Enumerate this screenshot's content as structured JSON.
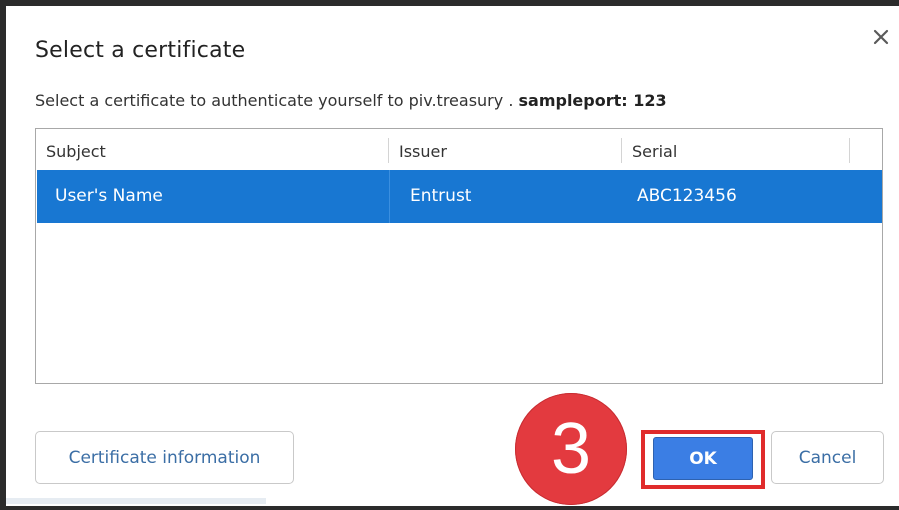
{
  "dialog": {
    "title": "Select a certificate",
    "description_prefix": "Select a certificate to authenticate yourself to piv.treasury",
    "description_separator": " . ",
    "description_host": "sampleport: 123",
    "close_icon": "close-icon"
  },
  "table": {
    "columns": [
      "Subject",
      "Issuer",
      "Serial"
    ],
    "rows": [
      {
        "subject": "User's Name",
        "issuer": "Entrust",
        "serial": "ABC123456",
        "selected": true
      }
    ]
  },
  "buttons": {
    "certificate_info": "Certificate information",
    "ok": "OK",
    "cancel": "Cancel"
  },
  "annotation": {
    "step_number": "3",
    "badge_color": "#e33a3f",
    "highlight_color": "#e02b2b"
  },
  "colors": {
    "selection": "#1877d2",
    "primary_button": "#3b7ee4",
    "link_text": "#3b6ea5"
  }
}
